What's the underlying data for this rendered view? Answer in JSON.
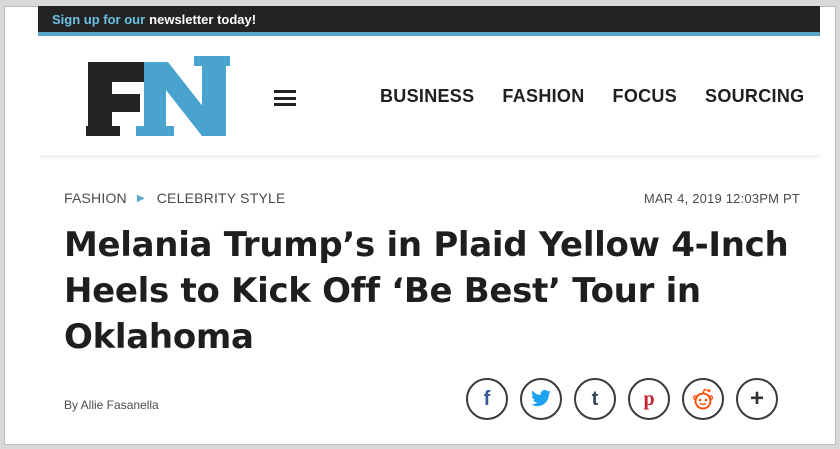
{
  "newsletter": {
    "accent": "Sign up for our",
    "text": "newsletter today!"
  },
  "logo": {
    "letters": "FN",
    "dark_color": "#242424",
    "accent_color": "#4aa3cf"
  },
  "nav": {
    "menu_icon": "hamburger-icon",
    "items": [
      "BUSINESS",
      "FASHION",
      "FOCUS",
      "SOURCING"
    ]
  },
  "breadcrumb": {
    "section": "FASHION",
    "separator_icon": "chevron-right-icon",
    "subsection": "CELEBRITY STYLE"
  },
  "datetime": "MAR 4, 2019 12:03PM PT",
  "article": {
    "headline": "Melania Trump’s in Plaid Yellow 4-Inch Heels to Kick Off ‘Be Best’ Tour in Oklahoma",
    "byline": "By Allie Fasanella"
  },
  "share": [
    {
      "network": "facebook",
      "icon": "facebook-icon",
      "glyph": "f"
    },
    {
      "network": "twitter",
      "icon": "twitter-icon",
      "glyph": ""
    },
    {
      "network": "tumblr",
      "icon": "tumblr-icon",
      "glyph": "t"
    },
    {
      "network": "pinterest",
      "icon": "pinterest-icon",
      "glyph": "p"
    },
    {
      "network": "reddit",
      "icon": "reddit-icon",
      "glyph": ""
    },
    {
      "network": "more",
      "icon": "plus-icon",
      "glyph": "+"
    }
  ],
  "colors": {
    "accent": "#5aa7c9",
    "bar": "#232323",
    "text": "#1e1e1e",
    "share_facebook": "#3b5998",
    "share_twitter": "#1da1f2",
    "share_tumblr": "#35465c",
    "share_pinterest": "#c8232c",
    "share_reddit": "#ff4500"
  }
}
